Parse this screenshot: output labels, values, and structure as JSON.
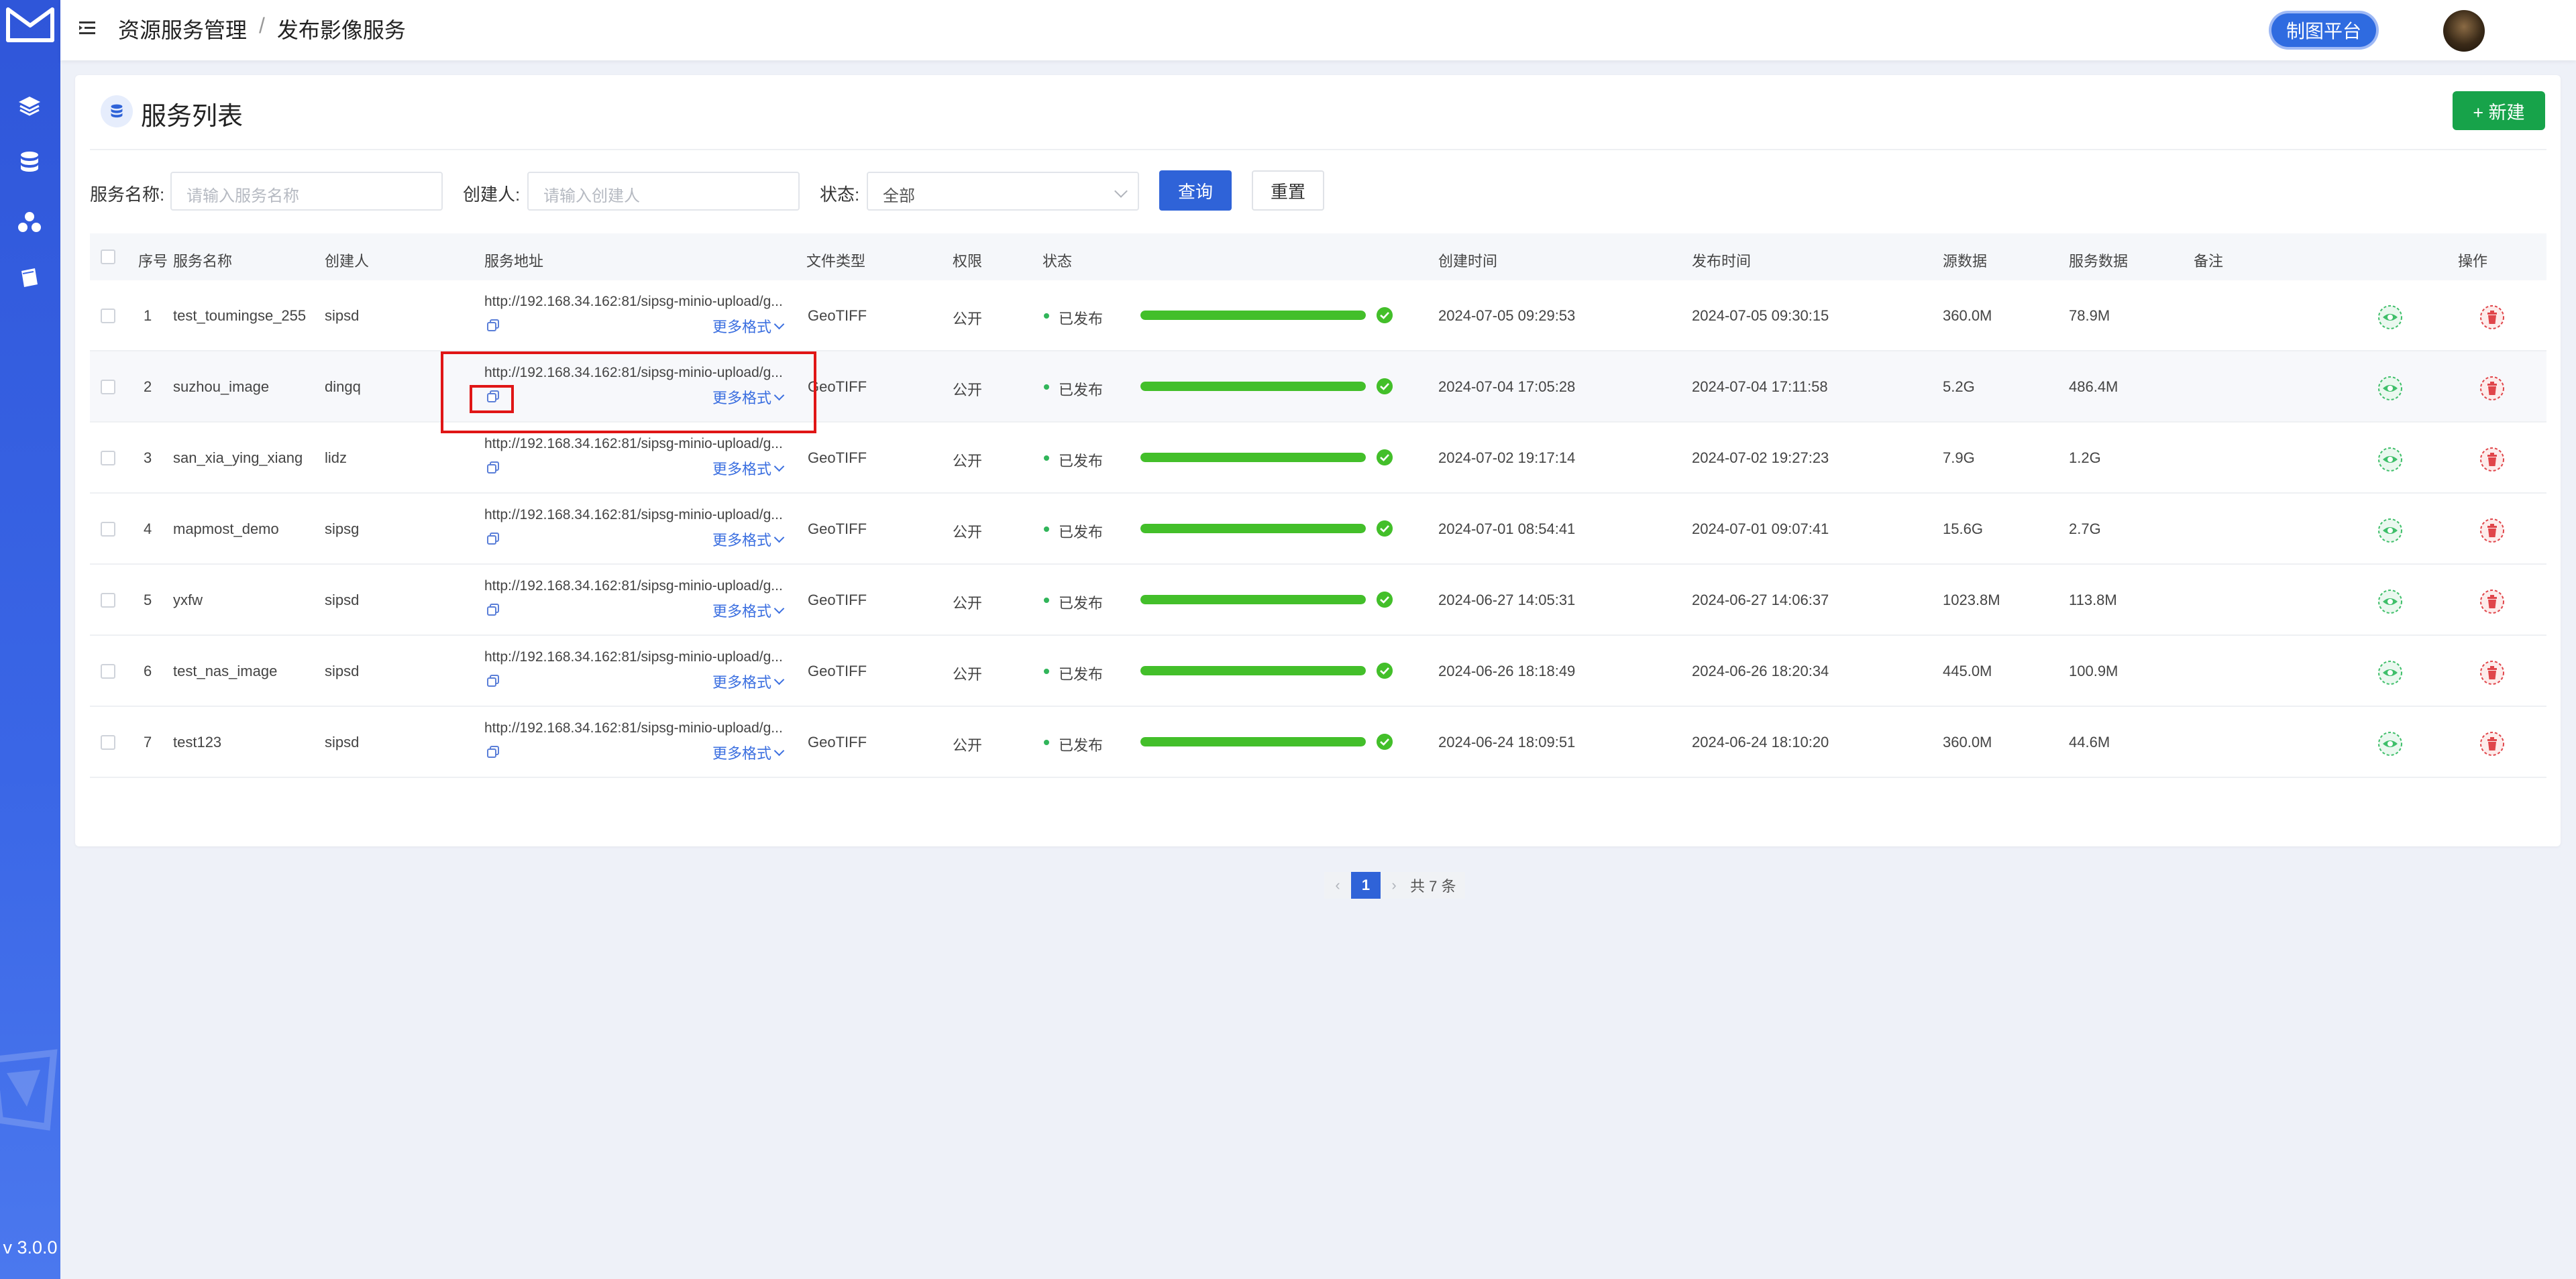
{
  "app": {
    "version": "v 3.0.0"
  },
  "header": {
    "breadcrumb": [
      "资源服务管理",
      "发布影像服务"
    ],
    "breadcrumb_sep": "/",
    "platform_button": "制图平台"
  },
  "card": {
    "title": "服务列表",
    "new_button": "+ 新建"
  },
  "filters": {
    "name_label": "服务名称:",
    "name_placeholder": "请输入服务名称",
    "creator_label": "创建人:",
    "creator_placeholder": "请输入创建人",
    "status_label": "状态:",
    "status_value": "全部",
    "query_button": "查询",
    "reset_button": "重置"
  },
  "table": {
    "columns": [
      "序号",
      "服务名称",
      "创建人",
      "服务地址",
      "文件类型",
      "权限",
      "状态",
      "创建时间",
      "发布时间",
      "源数据",
      "服务数据",
      "备注",
      "操作"
    ],
    "more_formats_label": "更多格式",
    "rows": [
      {
        "idx": "1",
        "name": "test_toumingse_255",
        "creator": "sipsd",
        "url": "http://192.168.34.162:81/sipsg-minio-upload/g...",
        "type": "GeoTIFF",
        "perm": "公开",
        "status": "已发布",
        "progress": 1.0,
        "created": "2024-07-05 09:29:53",
        "published": "2024-07-05 09:30:15",
        "src": "360.0M",
        "svc": "78.9M",
        "note": ""
      },
      {
        "idx": "2",
        "name": "suzhou_image",
        "creator": "dingq",
        "url": "http://192.168.34.162:81/sipsg-minio-upload/g...",
        "type": "GeoTIFF",
        "perm": "公开",
        "status": "已发布",
        "progress": 1.0,
        "created": "2024-07-04 17:05:28",
        "published": "2024-07-04 17:11:58",
        "src": "5.2G",
        "svc": "486.4M",
        "note": ""
      },
      {
        "idx": "3",
        "name": "san_xia_ying_xiang",
        "creator": "lidz",
        "url": "http://192.168.34.162:81/sipsg-minio-upload/g...",
        "type": "GeoTIFF",
        "perm": "公开",
        "status": "已发布",
        "progress": 1.0,
        "created": "2024-07-02 19:17:14",
        "published": "2024-07-02 19:27:23",
        "src": "7.9G",
        "svc": "1.2G",
        "note": ""
      },
      {
        "idx": "4",
        "name": "mapmost_demo",
        "creator": "sipsg",
        "url": "http://192.168.34.162:81/sipsg-minio-upload/g...",
        "type": "GeoTIFF",
        "perm": "公开",
        "status": "已发布",
        "progress": 1.0,
        "created": "2024-07-01 08:54:41",
        "published": "2024-07-01 09:07:41",
        "src": "15.6G",
        "svc": "2.7G",
        "note": ""
      },
      {
        "idx": "5",
        "name": "yxfw",
        "creator": "sipsd",
        "url": "http://192.168.34.162:81/sipsg-minio-upload/g...",
        "type": "GeoTIFF",
        "perm": "公开",
        "status": "已发布",
        "progress": 1.0,
        "created": "2024-06-27 14:05:31",
        "published": "2024-06-27 14:06:37",
        "src": "1023.8M",
        "svc": "113.8M",
        "note": ""
      },
      {
        "idx": "6",
        "name": "test_nas_image",
        "creator": "sipsd",
        "url": "http://192.168.34.162:81/sipsg-minio-upload/g...",
        "type": "GeoTIFF",
        "perm": "公开",
        "status": "已发布",
        "progress": 1.0,
        "created": "2024-06-26 18:18:49",
        "published": "2024-06-26 18:20:34",
        "src": "445.0M",
        "svc": "100.9M",
        "note": ""
      },
      {
        "idx": "7",
        "name": "test123",
        "creator": "sipsd",
        "url": "http://192.168.34.162:81/sipsg-minio-upload/g...",
        "type": "GeoTIFF",
        "perm": "公开",
        "status": "已发布",
        "progress": 1.0,
        "created": "2024-06-24 18:09:51",
        "published": "2024-06-24 18:10:20",
        "src": "360.0M",
        "svc": "44.6M",
        "note": ""
      }
    ]
  },
  "pagination": {
    "current": "1",
    "total_text": "共 7 条",
    "prev": "‹",
    "next": "›"
  },
  "colors": {
    "primary": "#2f63d8",
    "success": "#43bf2a",
    "danger": "#e0454a",
    "new": "#17a34a"
  },
  "icons": [
    "menu-fold-icon",
    "layers-icon",
    "database-icon",
    "cluster-icon",
    "book-icon",
    "copy-icon",
    "chevron-down-icon",
    "check-circle-icon",
    "eye-icon",
    "trash-icon"
  ]
}
